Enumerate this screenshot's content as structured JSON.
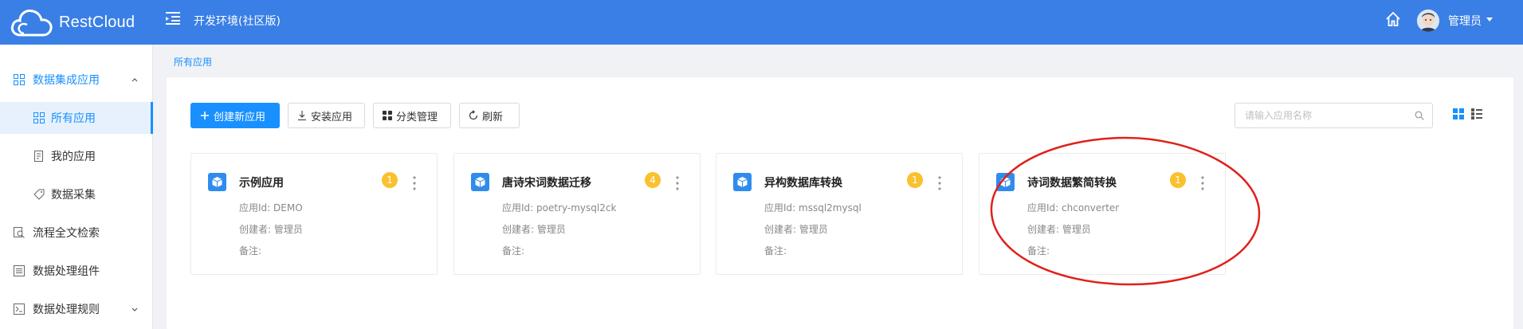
{
  "header": {
    "logo_text": "RestCloud",
    "env_title": "开发环境(社区版)",
    "user_name": "管理员"
  },
  "sidebar": {
    "items": [
      {
        "label": "数据集成应用",
        "icon": "grid-icon",
        "type": "group",
        "expanded": true
      },
      {
        "label": "所有应用",
        "icon": "grid-icon",
        "type": "sub",
        "active": true
      },
      {
        "label": "我的应用",
        "icon": "document-icon",
        "type": "sub"
      },
      {
        "label": "数据采集",
        "icon": "tag-icon",
        "type": "sub"
      },
      {
        "label": "流程全文检索",
        "icon": "search-doc-icon",
        "type": "top"
      },
      {
        "label": "数据处理组件",
        "icon": "list-icon",
        "type": "top"
      },
      {
        "label": "数据处理规则",
        "icon": "terminal-icon",
        "type": "top",
        "expanded": false
      }
    ]
  },
  "breadcrumb": "所有应用",
  "toolbar": {
    "create_label": "创建新应用",
    "install_label": "安装应用",
    "category_label": "分类管理",
    "refresh_label": "刷新"
  },
  "search": {
    "placeholder": "请输入应用名称",
    "value": ""
  },
  "cards": [
    {
      "name": "示例应用",
      "badge": "1",
      "id_label": "应用Id:",
      "id_value": "DEMO",
      "creator_label": "创建者:",
      "creator_value": "管理员",
      "note_label": "备注:"
    },
    {
      "name": "唐诗宋词数据迁移",
      "badge": "4",
      "id_label": "应用Id:",
      "id_value": "poetry-mysql2ck",
      "creator_label": "创建者:",
      "creator_value": "管理员",
      "note_label": "备注:"
    },
    {
      "name": "异构数据库转换",
      "badge": "1",
      "id_label": "应用Id:",
      "id_value": "mssql2mysql",
      "creator_label": "创建者:",
      "creator_value": "管理员",
      "note_label": "备注:"
    },
    {
      "name": "诗词数据繁简转换",
      "badge": "1",
      "id_label": "应用Id:",
      "id_value": "chconverter",
      "creator_label": "创建者:",
      "creator_value": "管理员",
      "note_label": "备注:"
    }
  ],
  "colors": {
    "header_bg": "#3a7fe6",
    "accent": "#1890ff",
    "badge": "#fbc02d",
    "annotation": "#e0201a"
  }
}
